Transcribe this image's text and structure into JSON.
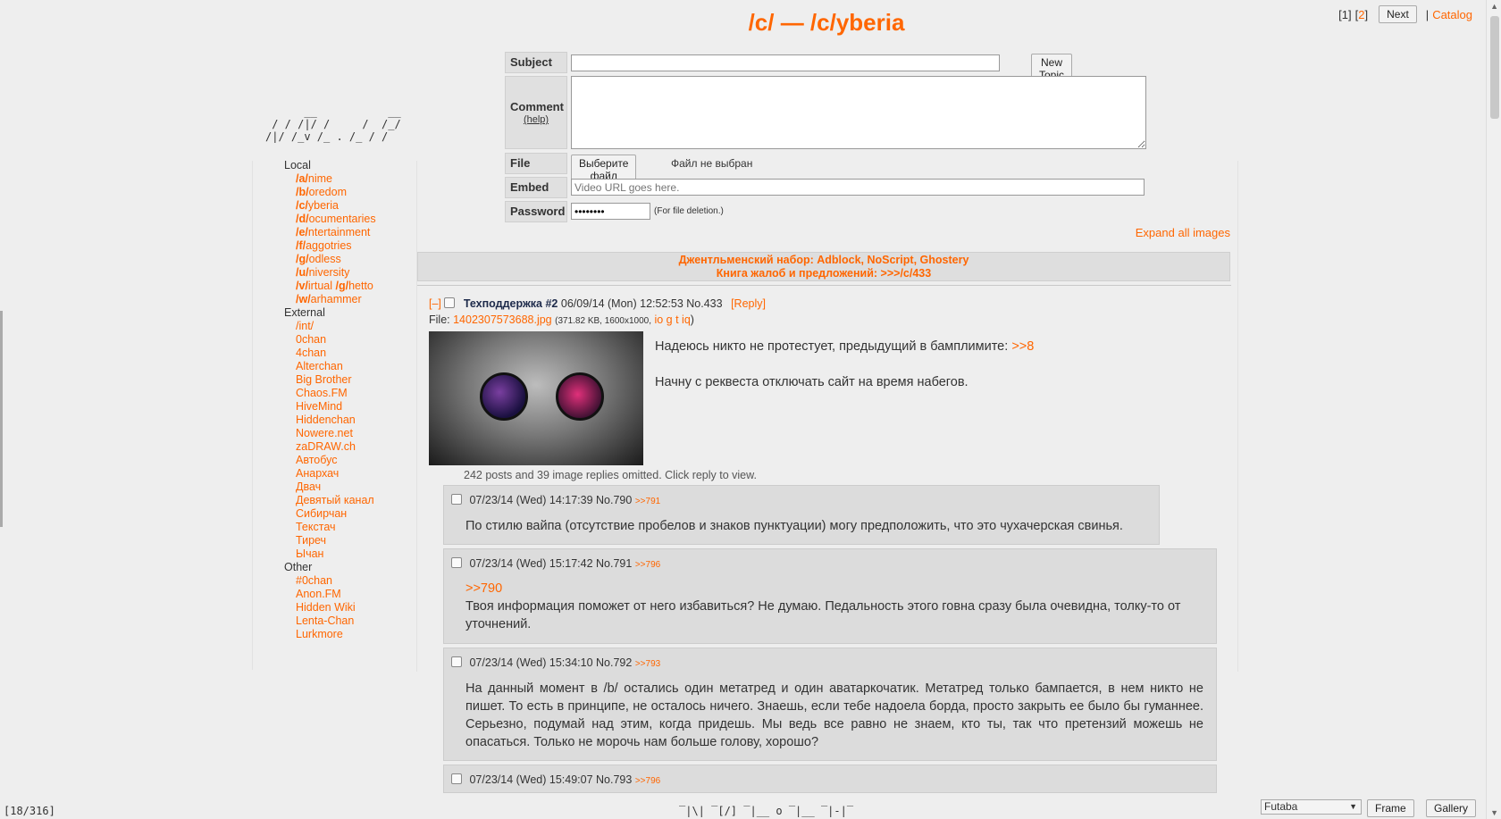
{
  "header": {
    "title": "/c/ — /c/yberia"
  },
  "top_nav": {
    "page1": "[1]",
    "page2_open": "[",
    "page2": "2",
    "page2_close": "]",
    "next_label": "Next",
    "separator": "|",
    "catalog": "Catalog"
  },
  "ascii_logo": "      __           __\n / / /|/ /     /  /_/\n/|/ /_v /_ . /_ / /",
  "sidebar": {
    "local_heading": "Local",
    "local": [
      {
        "prefix": "/a/",
        "rest": "nime"
      },
      {
        "prefix": "/b/",
        "rest": "oredom"
      },
      {
        "prefix": "/c/",
        "rest": "yberia"
      },
      {
        "prefix": "/d/",
        "rest": "ocumentaries"
      },
      {
        "prefix": "/e/",
        "rest": "ntertainment"
      },
      {
        "prefix": "/f/",
        "rest": "aggotries"
      },
      {
        "prefix": "/g/",
        "rest": "odless"
      },
      {
        "prefix": "/u/",
        "rest": "niversity"
      },
      {
        "prefix": "/v/",
        "rest": "irtual ",
        "prefix2": "/g/",
        "rest2": "hetto"
      },
      {
        "prefix": "/w/",
        "rest": "arhammer"
      }
    ],
    "external_heading": "External",
    "external": [
      "/int/",
      "0chan",
      "4chan",
      "Alterchan",
      "Big Brother",
      "Chaos.FM",
      "HiveMind",
      "Hiddenchan",
      "Nowere.net",
      "zaDRAW.ch",
      "Автобус",
      "Анархач",
      "Двач",
      "Девятый канал",
      "Сибирчан",
      "Текстач",
      "Тиреч",
      "Ычан"
    ],
    "other_heading": "Other",
    "other": [
      "#0chan",
      "Anon.FM",
      "Hidden Wiki",
      "Lenta-Chan",
      "Lurkmore"
    ]
  },
  "form": {
    "subject_label": "Subject",
    "subject_value": "",
    "new_topic_button": "New Topic",
    "comment_label": "Comment",
    "help_link": "(help)",
    "file_label": "File",
    "file_button": "Выберите файл",
    "file_status": "Файл не выбран",
    "embed_label": "Embed",
    "embed_placeholder": "Video URL goes here.",
    "password_label": "Password",
    "password_value": "********",
    "password_note": "(For file deletion.)"
  },
  "expand_all": "Expand all images",
  "announcement": {
    "line1": "Джентльменский набор: Adblock, NoScript, Ghostery",
    "line2": "Книга жалоб и предложений: >>>/c/433"
  },
  "op": {
    "toggle": "[–]",
    "subject": "Техподдержка #2",
    "date": "06/09/14 (Mon) 12:52:53",
    "no_label": "No.",
    "no": "433",
    "reply_link": "[Reply]",
    "file_label": "File:",
    "file_name": "1402307573688.jpg",
    "file_meta": "(371.82 KB, 1600x1000,",
    "file_links": "io g t iq",
    "file_meta_close": ")",
    "quote_text": "Надеюсь никто не протестует, предыдущий в бамплимите:",
    "quote_link": ">>8",
    "text2": "Начну с реквеста отключать сайт на время набегов.",
    "omitted": "242 posts and 39 image replies omitted. Click reply to view."
  },
  "replies": [
    {
      "date": "07/23/14 (Wed) 14:17:39",
      "no": "790",
      "backlink": ">>791",
      "body_link": "",
      "body": "По стилю вайпа (отсутствие пробелов и знаков пунктуации) могу предположить, что это чухачерская свинья."
    },
    {
      "date": "07/23/14 (Wed) 15:17:42",
      "no": "791",
      "backlink": ">>796",
      "body_link": ">>790",
      "body": "Твоя информация поможет от него избавиться? Не думаю. Педальность этого говна сразу была очевидна, толку-то от уточнений."
    },
    {
      "date": "07/23/14 (Wed) 15:34:10",
      "no": "792",
      "backlink": ">>793",
      "body_link": "",
      "body": "На данный момент в /b/ остались один метатред и один аватаркочатик. Метатред только бампается, в нем никто не пишет. То есть в принципе, не осталось ничего. Знаешь, если тебе надоела борда, просто закрыть ее было бы гуманнее. Серьезно, подумай над этим, когда придешь. Мы ведь  все равно не знаем, кто ты, так что претензий можешь не опасаться. Только не морочь нам больше голову, хорошо?"
    },
    {
      "date": "07/23/14 (Wed) 15:49:07",
      "no": "793",
      "backlink": ">>796",
      "body_link": "",
      "body": ""
    }
  ],
  "footer": {
    "status": "[18/316]",
    "art": "‾|\\| ‾[/] ‾|__ o ‾|__ ‾|-|‾",
    "style_select": "Futaba",
    "frame_button": "Frame",
    "gallery_button": "Gallery"
  },
  "colors": {
    "accent": "#ff6600",
    "background": "#eeeeee",
    "reply_bg": "#dcdcdc",
    "subject": "#1d2a4a"
  }
}
